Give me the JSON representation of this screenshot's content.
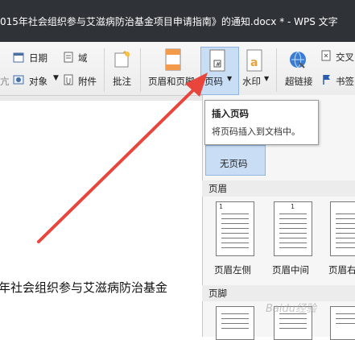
{
  "window": {
    "title": "015年社会组织参与艾滋病防治基金项目申请指南》的通知.docx * - WPS 文字"
  },
  "ribbon": {
    "date_label": "日期",
    "field_label": "域",
    "object_label": "对象",
    "attachment_label": "附件",
    "annotation_label": "批注",
    "header_footer_label": "页眉和页脚",
    "page_number_label": "页码",
    "watermark_label": "水印",
    "hyperlink_label": "超链接",
    "crossref_label": "交叉",
    "bookmark_label": "书签",
    "truncated_left_char": "亢"
  },
  "tooltip": {
    "title": "插入页码",
    "description": "将页码插入到文档中。"
  },
  "dropdown": {
    "none_label": "无页码",
    "header_section": "页眉",
    "header_items": [
      "页眉左侧",
      "页眉中间",
      "页眉右侧"
    ],
    "footer_section": "页脚",
    "thumb_number": "1"
  },
  "document": {
    "visible_text": "年社会组织参与艾滋病防治基金"
  },
  "colors": {
    "title_bar": "#2f3337",
    "arrow": "#e8453c",
    "selected": "#c9ddf4"
  },
  "icons": [
    "date-icon",
    "field-icon",
    "object-icon",
    "attachment-icon",
    "annotation-icon",
    "header-footer-icon",
    "page-number-icon",
    "watermark-icon",
    "hyperlink-icon",
    "crossref-icon",
    "bookmark-flag-icon"
  ],
  "watermark_logo": "Baidu经验"
}
